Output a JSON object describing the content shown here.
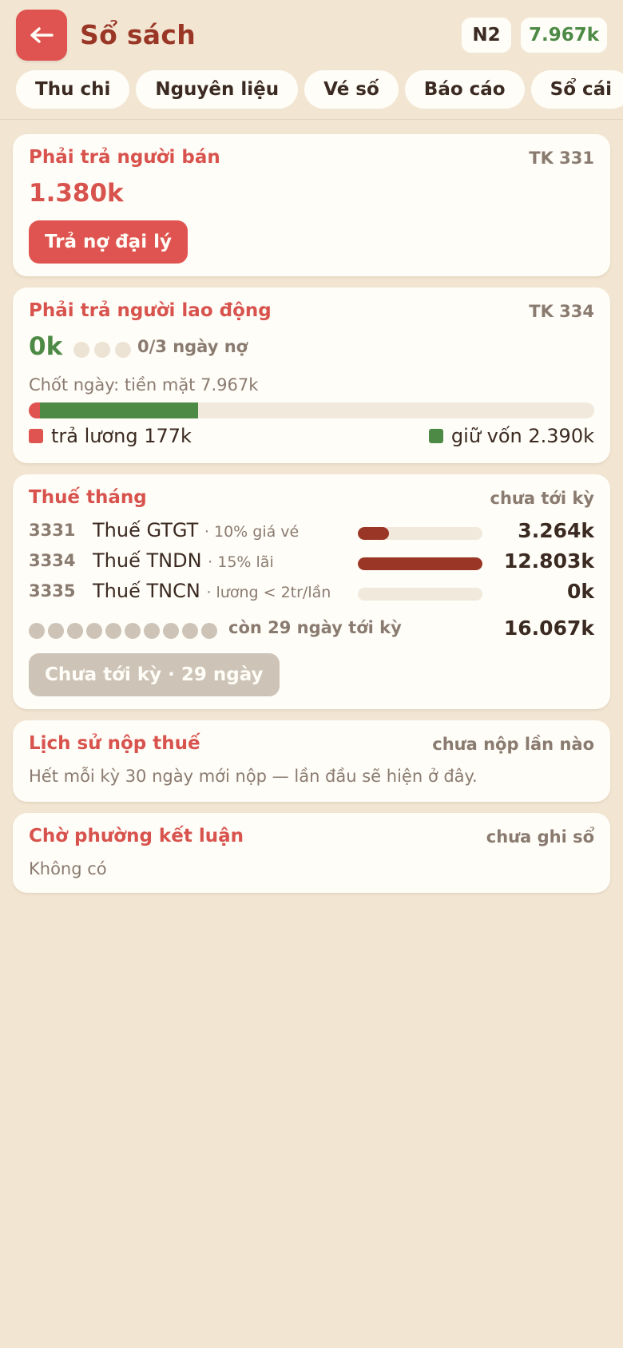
{
  "header": {
    "title": "Sổ sách",
    "day_label": "N2",
    "cash_label": "7.967k"
  },
  "tabs": [
    {
      "label": "Thu chi"
    },
    {
      "label": "Nguyên liệu"
    },
    {
      "label": "Vé số"
    },
    {
      "label": "Báo cáo"
    },
    {
      "label": "Sổ cái"
    }
  ],
  "payable_seller": {
    "title": "Phải trả người bán",
    "account": "TK 331",
    "amount": "1.380k",
    "button_label": "Trả nợ đại lý"
  },
  "payable_labor": {
    "title": "Phải trả người lao động",
    "account": "TK 334",
    "amount": "0k",
    "debt_days": "0/3 ngày nợ",
    "debt_days_filled": 0,
    "debt_days_total": 3,
    "close_line": "Chốt ngày: tiền mặt 7.967k",
    "split": {
      "red_fraction": 0.02,
      "green_fraction": 0.28
    },
    "legend_left": "trả lương 177k",
    "legend_right": "giữ vốn 2.390k",
    "colors": {
      "red": "#df5450",
      "green": "#4d8a46"
    }
  },
  "monthly_tax": {
    "title": "Thuế tháng",
    "status": "chưa tới kỳ",
    "rows": [
      {
        "code": "3331",
        "name": "Thuế GTGT",
        "note": "· 10% giá vé",
        "amount": "3.264k",
        "fill": 0.25
      },
      {
        "code": "3334",
        "name": "Thuế TNDN",
        "note": "· 15% lãi",
        "amount": "12.803k",
        "fill": 1.0
      },
      {
        "code": "3335",
        "name": "Thuế TNCN",
        "note": "· lương < 2tr/lần",
        "amount": "0k",
        "fill": 0
      }
    ],
    "period_dots_total": 10,
    "period_text": "còn 29 ngày tới kỳ",
    "total": "16.067k",
    "button_label": "Chưa tới kỳ · 29 ngày"
  },
  "tax_history": {
    "title": "Lịch sử nộp thuế",
    "status": "chưa nộp lần nào",
    "description": "Hết mỗi kỳ 30 ngày mới nộp — lần đầu sẽ hiện ở đây."
  },
  "ward_conclusion": {
    "title": "Chờ phường kết luận",
    "status": "chưa ghi sổ",
    "description": "Không có"
  }
}
